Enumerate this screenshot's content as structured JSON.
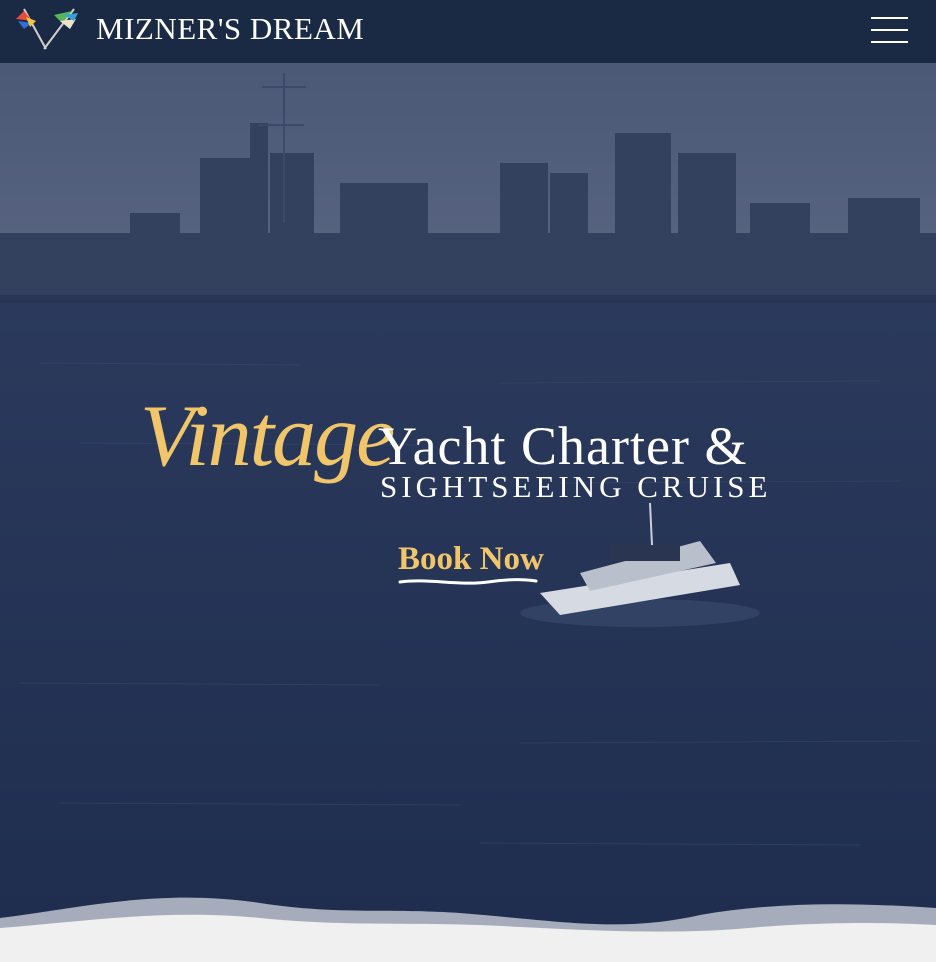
{
  "brand": {
    "name": "MIZNER'S DREAM"
  },
  "header": {
    "menu_icon": "hamburger-menu-icon"
  },
  "hero": {
    "headline_script": "Vintage",
    "headline_main": "Yacht Charter &",
    "headline_sub": "SIGHTSEEING CRUISE",
    "cta_label": "Book Now"
  },
  "colors": {
    "header_bg": "#1b2a44",
    "accent_gold": "#f1c66a",
    "text_white": "#ffffff",
    "footer_bg": "#f0f0f0"
  }
}
